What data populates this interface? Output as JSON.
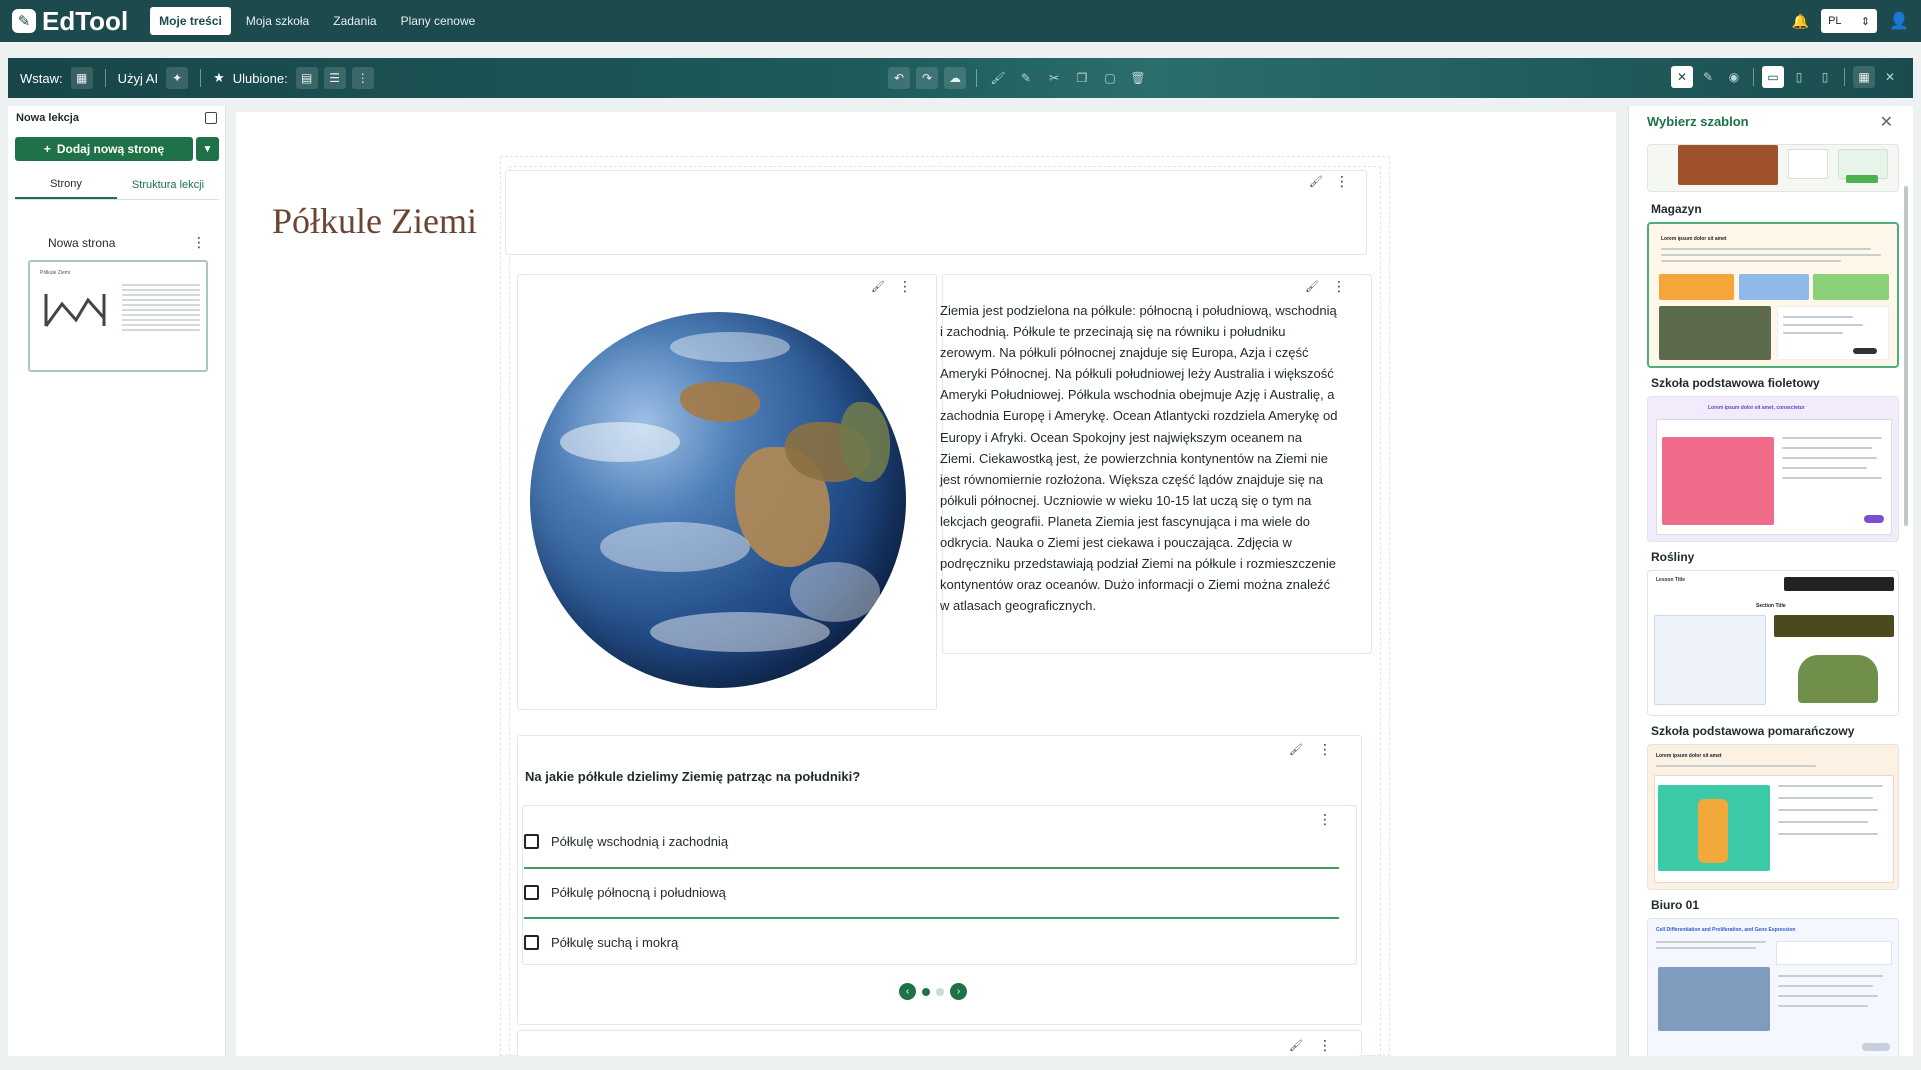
{
  "app": {
    "logo": "EdTool",
    "nav": [
      "Moje treści",
      "Moja szkoła",
      "Zadania",
      "Plany cenowe"
    ],
    "language": "PL"
  },
  "toolbar": {
    "insert_label": "Wstaw:",
    "ai_label": "Użyj AI",
    "favorites_label": "Ulubione:"
  },
  "left_panel": {
    "title": "Nowa lekcja",
    "add_page": "Dodaj nową stronę",
    "tabs": [
      "Strony",
      "Struktura lekcji"
    ],
    "pages": [
      {
        "name": "Nowa strona",
        "thumb_title": "Półkule Ziemi"
      }
    ]
  },
  "lesson": {
    "title": "Półkule Ziemi",
    "paragraph": "Ziemia jest podzielona na półkule: północną i południową, wschodnią i zachodnią. Półkule te przecinają się na równiku i południku zerowym. Na półkuli północnej znajduje się Europa, Azja i część Ameryki Północnej. Na półkuli południowej leży Australia i większość Ameryki Południowej. Półkula wschodnia obejmuje Azję i Australię, a zachodnia Europę i Amerykę. Ocean Atlantycki rozdziela Amerykę od Europy i Afryki. Ocean Spokojny jest największym oceanem na Ziemi. Ciekawostką jest, że powierzchnia kontynentów na Ziemi nie jest równomiernie rozłożona. Większa część lądów znajduje się na półkuli północnej. Uczniowie w wieku 10-15 lat uczą się o tym na lekcjach geografii. Planeta Ziemia jest fascynująca i ma wiele do odkrycia. Nauka o Ziemi jest ciekawa i pouczająca. Zdjęcia w podręczniku przedstawiają podział Ziemi na półkule i rozmieszczenie kontynentów oraz oceanów. Dużo informacji o Ziemi można znaleźć w atlasach geograficznych.",
    "question": "Na jakie półkule dzielimy Ziemię patrząc na południki?",
    "answers": [
      "Półkulę wschodnią i zachodnią",
      "Półkulę północną i południową",
      "Półkulę suchą i mokrą"
    ]
  },
  "templates_panel": {
    "title": "Wybierz szablon",
    "templates": [
      "Magazyn",
      "Szkoła podstawowa fioletowy",
      "Rośliny",
      "Szkoła podstawowa pomarańczowy",
      "Biuro 01"
    ],
    "thumb_texts": {
      "lorem_short": "Lorem ipsum dolor sit amet",
      "lorem_comma": "Lorem ipsum dolor sit amet, consectetur",
      "section_title": "Section Title",
      "lesson_title": "Lesson Title",
      "cell_title": "Cell Differentiation and Proliferation, and Gene Expression"
    }
  },
  "colors": {
    "primary": "#1d4b4d",
    "accent": "#1f7247",
    "title_brown": "#6b4433",
    "answer_line": "#3f9b62"
  }
}
